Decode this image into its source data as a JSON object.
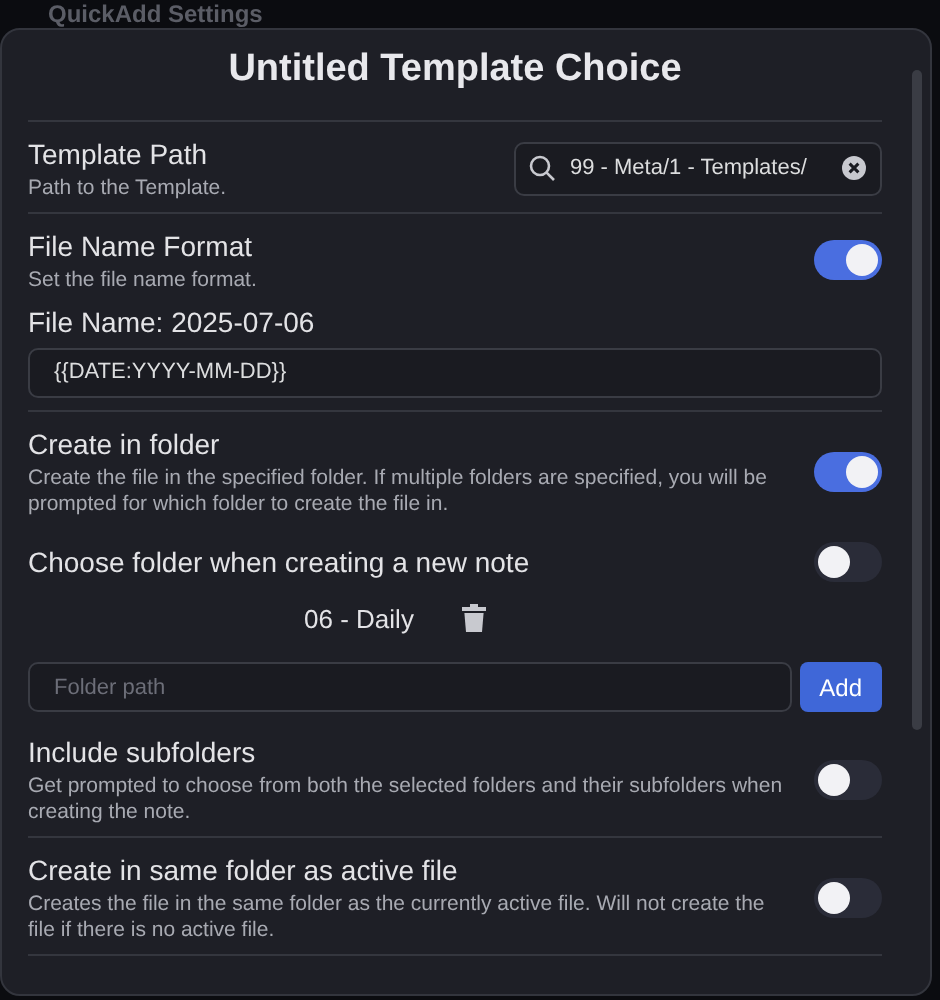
{
  "background_title": "QuickAdd Settings",
  "modal": {
    "title": "Untitled Template Choice",
    "sections": [
      [
        {
          "kind": "search",
          "name": "Template Path",
          "description": "Path to the Template.",
          "value": "99 - Meta/1 - Templates/"
        }
      ],
      [
        {
          "kind": "toggle",
          "name": "File Name Format",
          "description": "Set the file name format.",
          "on": true
        },
        {
          "kind": "text",
          "name": "File Name: 2025-07-06",
          "value": "{{DATE:YYYY-MM-DD}}"
        }
      ],
      [
        {
          "kind": "toggle",
          "name": "Create in folder",
          "description": "Create the file in the specified folder. If multiple folders are specified, you will be prompted for which folder to create the file in.",
          "on": true
        },
        {
          "kind": "toggle",
          "name": "Choose folder when creating a new note",
          "on": false
        },
        {
          "kind": "folders",
          "folders": [
            "06 - Daily"
          ],
          "placeholder": "Folder path",
          "button": "Add"
        },
        {
          "kind": "toggle",
          "name": "Include subfolders",
          "description": "Get prompted to choose from both the selected folders and their subfolders when creating the note.",
          "on": false
        }
      ],
      [
        {
          "kind": "toggle",
          "name": "Create in same folder as active file",
          "description": "Creates the file in the same folder as the currently active file. Will not create the file if there is no active file.",
          "on": false
        }
      ]
    ]
  }
}
